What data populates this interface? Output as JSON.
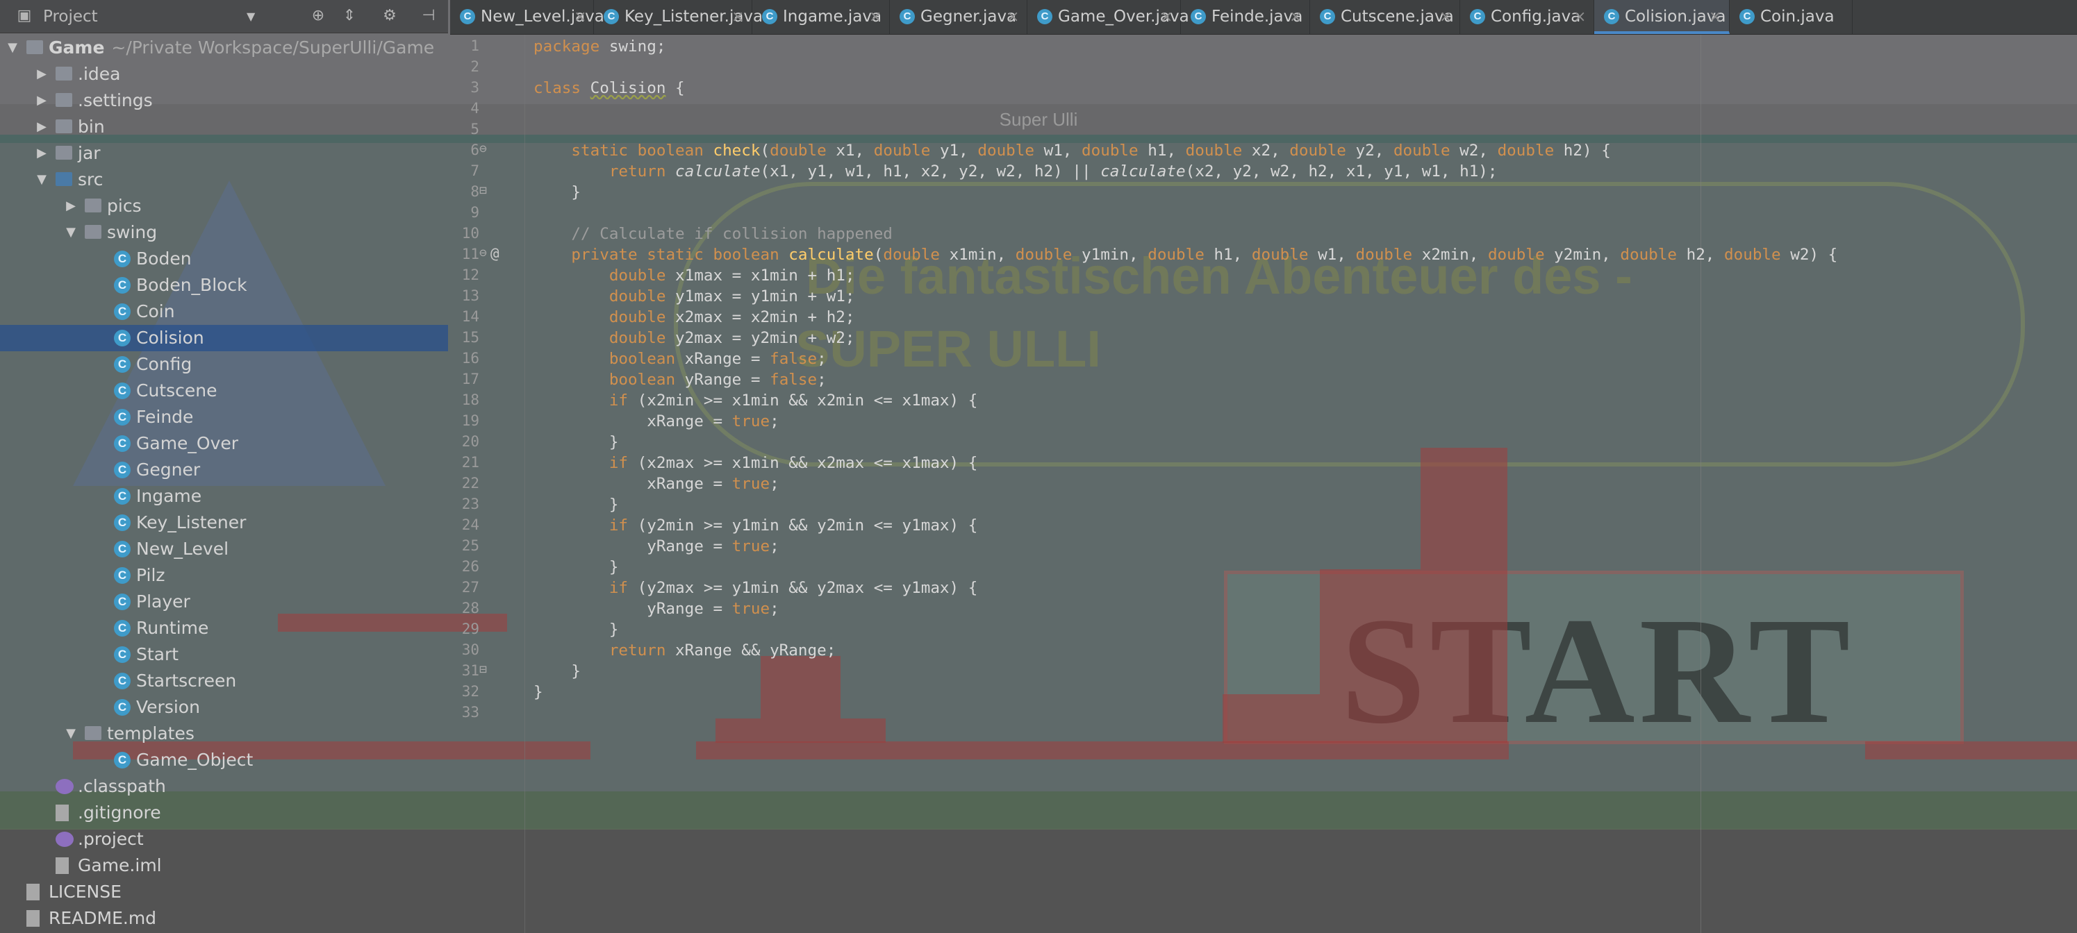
{
  "game_window": {
    "title": "Super Ulli",
    "bubble_line1": "Die fantastischen Abenteuer des -",
    "bubble_line2": "SUPER ULLI",
    "start_label": "START"
  },
  "project_panel": {
    "title": "Project",
    "tree": [
      {
        "label": "Game",
        "path": "~/Private Workspace/SuperUlli/Game",
        "icon": "module-folder-icon",
        "indent": 0,
        "arrow": "expanded",
        "bold": true
      },
      {
        "label": ".idea",
        "icon": "folder-icon",
        "indent": 1,
        "arrow": "collapsed"
      },
      {
        "label": ".settings",
        "icon": "folder-icon",
        "indent": 1,
        "arrow": "collapsed"
      },
      {
        "label": "bin",
        "icon": "folder-icon",
        "indent": 1,
        "arrow": "collapsed"
      },
      {
        "label": "jar",
        "icon": "folder-icon",
        "indent": 1,
        "arrow": "collapsed"
      },
      {
        "label": "src",
        "icon": "source-folder-icon",
        "indent": 1,
        "arrow": "expanded"
      },
      {
        "label": "pics",
        "icon": "package-icon",
        "indent": 2,
        "arrow": "collapsed"
      },
      {
        "label": "swing",
        "icon": "package-icon",
        "indent": 2,
        "arrow": "expanded"
      },
      {
        "label": "Boden",
        "icon": "java-class-icon",
        "indent": 3
      },
      {
        "label": "Boden_Block",
        "icon": "java-class-icon",
        "indent": 3
      },
      {
        "label": "Coin",
        "icon": "java-class-icon",
        "indent": 3
      },
      {
        "label": "Colision",
        "icon": "java-class-icon",
        "indent": 3,
        "selected": true
      },
      {
        "label": "Config",
        "icon": "java-class-icon",
        "indent": 3
      },
      {
        "label": "Cutscene",
        "icon": "java-class-icon",
        "indent": 3
      },
      {
        "label": "Feinde",
        "icon": "java-class-icon",
        "indent": 3
      },
      {
        "label": "Game_Over",
        "icon": "java-class-icon",
        "indent": 3
      },
      {
        "label": "Gegner",
        "icon": "java-class-icon",
        "indent": 3
      },
      {
        "label": "Ingame",
        "icon": "java-class-icon",
        "indent": 3
      },
      {
        "label": "Key_Listener",
        "icon": "java-class-icon",
        "indent": 3
      },
      {
        "label": "New_Level",
        "icon": "java-class-icon",
        "indent": 3
      },
      {
        "label": "Pilz",
        "icon": "java-class-icon",
        "indent": 3
      },
      {
        "label": "Player",
        "icon": "java-class-icon",
        "indent": 3
      },
      {
        "label": "Runtime",
        "icon": "java-class-icon",
        "indent": 3
      },
      {
        "label": "Start",
        "icon": "java-class-icon",
        "indent": 3
      },
      {
        "label": "Startscreen",
        "icon": "java-class-icon",
        "indent": 3
      },
      {
        "label": "Version",
        "icon": "java-class-icon",
        "indent": 3
      },
      {
        "label": "templates",
        "icon": "package-icon",
        "indent": 2,
        "arrow": "expanded"
      },
      {
        "label": "Game_Object",
        "icon": "java-class-icon",
        "indent": 3
      },
      {
        "label": ".classpath",
        "icon": "classpath-icon",
        "indent": 1
      },
      {
        "label": ".gitignore",
        "icon": "file-icon",
        "indent": 1
      },
      {
        "label": ".project",
        "icon": "classpath-icon",
        "indent": 1
      },
      {
        "label": "Game.iml",
        "icon": "file-icon",
        "indent": 1
      },
      {
        "label": "LICENSE",
        "icon": "file-icon",
        "indent": 0
      },
      {
        "label": "README.md",
        "icon": "markdown-icon",
        "indent": 0
      }
    ]
  },
  "editor": {
    "tabs": [
      {
        "label": "New_Level.java"
      },
      {
        "label": "Key_Listener.java"
      },
      {
        "label": "Ingame.java"
      },
      {
        "label": "Gegner.java"
      },
      {
        "label": "Game_Over.java"
      },
      {
        "label": "Feinde.java"
      },
      {
        "label": "Cutscene.java"
      },
      {
        "label": "Config.java"
      },
      {
        "label": "Colision.java",
        "active": true
      },
      {
        "label": "Coin.java"
      }
    ],
    "lines": [
      {
        "n": "1",
        "segs": [
          [
            "kw",
            "package "
          ],
          [
            "",
            "swing;"
          ]
        ]
      },
      {
        "n": "2",
        "segs": []
      },
      {
        "n": "3",
        "segs": [
          [
            "kw",
            "class "
          ],
          [
            "un",
            "Colision"
          ],
          [
            "",
            " {"
          ]
        ]
      },
      {
        "n": "4",
        "segs": []
      },
      {
        "n": "5",
        "segs": []
      },
      {
        "n": "6",
        "segs": [
          [
            "",
            "    "
          ],
          [
            "kw",
            "static boolean "
          ],
          [
            "fn",
            "check"
          ],
          [
            "",
            "("
          ],
          [
            "kw",
            "double "
          ],
          [
            "",
            "x1, "
          ],
          [
            "kw",
            "double "
          ],
          [
            "",
            "y1, "
          ],
          [
            "kw",
            "double "
          ],
          [
            "",
            "w1, "
          ],
          [
            "kw",
            "double "
          ],
          [
            "",
            "h1, "
          ],
          [
            "kw",
            "double "
          ],
          [
            "",
            "x2, "
          ],
          [
            "kw",
            "double "
          ],
          [
            "",
            "y2, "
          ],
          [
            "kw",
            "double "
          ],
          [
            "",
            "w2, "
          ],
          [
            "kw",
            "double "
          ],
          [
            "",
            "h2) {"
          ]
        ]
      },
      {
        "n": "7",
        "segs": [
          [
            "",
            "        "
          ],
          [
            "kw",
            "return "
          ],
          [
            "it",
            "calculate"
          ],
          [
            "",
            "(x1, y1, w1, h1, x2, y2, w2, h2) || "
          ],
          [
            "it",
            "calculate"
          ],
          [
            "",
            "(x2, y2, w2, h2, x1, y1, w1, h1);"
          ]
        ]
      },
      {
        "n": "8",
        "segs": [
          [
            "",
            "    }"
          ]
        ]
      },
      {
        "n": "9",
        "segs": []
      },
      {
        "n": "10",
        "segs": [
          [
            "cm",
            "    // Calculate if collision happened"
          ]
        ]
      },
      {
        "n": "11",
        "segs": [
          [
            "",
            "    "
          ],
          [
            "kw",
            "private static boolean "
          ],
          [
            "fn",
            "calculate"
          ],
          [
            "",
            "("
          ],
          [
            "kw",
            "double "
          ],
          [
            "",
            "x1min, "
          ],
          [
            "kw",
            "double "
          ],
          [
            "",
            "y1min, "
          ],
          [
            "kw",
            "double "
          ],
          [
            "",
            "h1, "
          ],
          [
            "kw",
            "double "
          ],
          [
            "",
            "w1, "
          ],
          [
            "kw",
            "double "
          ],
          [
            "",
            "x2min, "
          ],
          [
            "kw",
            "double "
          ],
          [
            "",
            "y2min, "
          ],
          [
            "kw",
            "double "
          ],
          [
            "",
            "h2, "
          ],
          [
            "kw",
            "double "
          ],
          [
            "",
            "w2) {"
          ]
        ]
      },
      {
        "n": "12",
        "segs": [
          [
            "",
            "        "
          ],
          [
            "kw",
            "double "
          ],
          [
            "",
            "x1max = x1min + h1;"
          ]
        ]
      },
      {
        "n": "13",
        "segs": [
          [
            "",
            "        "
          ],
          [
            "kw",
            "double "
          ],
          [
            "",
            "y1max = y1min + w1;"
          ]
        ]
      },
      {
        "n": "14",
        "segs": [
          [
            "",
            "        "
          ],
          [
            "kw",
            "double "
          ],
          [
            "",
            "x2max = x2min + h2;"
          ]
        ]
      },
      {
        "n": "15",
        "segs": [
          [
            "",
            "        "
          ],
          [
            "kw",
            "double "
          ],
          [
            "",
            "y2max = y2min + w2;"
          ]
        ]
      },
      {
        "n": "16",
        "segs": [
          [
            "",
            "        "
          ],
          [
            "kw",
            "boolean "
          ],
          [
            "",
            "xRange = "
          ],
          [
            "kw",
            "false"
          ],
          [
            "",
            ";"
          ]
        ]
      },
      {
        "n": "17",
        "segs": [
          [
            "",
            "        "
          ],
          [
            "kw",
            "boolean "
          ],
          [
            "",
            "yRange = "
          ],
          [
            "kw",
            "false"
          ],
          [
            "",
            ";"
          ]
        ]
      },
      {
        "n": "18",
        "segs": [
          [
            "",
            "        "
          ],
          [
            "kw",
            "if "
          ],
          [
            "",
            "(x2min >= x1min && x2min <= x1max) {"
          ]
        ]
      },
      {
        "n": "19",
        "segs": [
          [
            "",
            "            xRange = "
          ],
          [
            "kw",
            "true"
          ],
          [
            "",
            ";"
          ]
        ]
      },
      {
        "n": "20",
        "segs": [
          [
            "",
            "        }"
          ]
        ]
      },
      {
        "n": "21",
        "segs": [
          [
            "",
            "        "
          ],
          [
            "kw",
            "if "
          ],
          [
            "",
            "(x2max >= x1min && x2max <= x1max) {"
          ]
        ]
      },
      {
        "n": "22",
        "segs": [
          [
            "",
            "            xRange = "
          ],
          [
            "kw",
            "true"
          ],
          [
            "",
            ";"
          ]
        ]
      },
      {
        "n": "23",
        "segs": [
          [
            "",
            "        }"
          ]
        ]
      },
      {
        "n": "24",
        "segs": [
          [
            "",
            "        "
          ],
          [
            "kw",
            "if "
          ],
          [
            "",
            "(y2min >= y1min && y2min <= y1max) {"
          ]
        ]
      },
      {
        "n": "25",
        "segs": [
          [
            "",
            "            yRange = "
          ],
          [
            "kw",
            "true"
          ],
          [
            "",
            ";"
          ]
        ]
      },
      {
        "n": "26",
        "segs": [
          [
            "",
            "        }"
          ]
        ]
      },
      {
        "n": "27",
        "segs": [
          [
            "",
            "        "
          ],
          [
            "kw",
            "if "
          ],
          [
            "",
            "(y2max >= y1min && y2max <= y1max) {"
          ]
        ]
      },
      {
        "n": "28",
        "segs": [
          [
            "",
            "            yRange = "
          ],
          [
            "kw",
            "true"
          ],
          [
            "",
            ";"
          ]
        ]
      },
      {
        "n": "29",
        "segs": [
          [
            "",
            "        }"
          ]
        ]
      },
      {
        "n": "30",
        "segs": [
          [
            "",
            "        "
          ],
          [
            "kw",
            "return "
          ],
          [
            "",
            "xRange && yRange;"
          ]
        ]
      },
      {
        "n": "31",
        "segs": [
          [
            "",
            "    }"
          ]
        ]
      },
      {
        "n": "32",
        "segs": [
          [
            "",
            "}"
          ]
        ]
      },
      {
        "n": "33",
        "segs": []
      }
    ],
    "gutter_annotation": "@"
  },
  "colors": {
    "keyword": "#d1904e",
    "method": "#ffcd6b",
    "selection": "#28508c",
    "java_class_icon": "#3f9bc9"
  }
}
